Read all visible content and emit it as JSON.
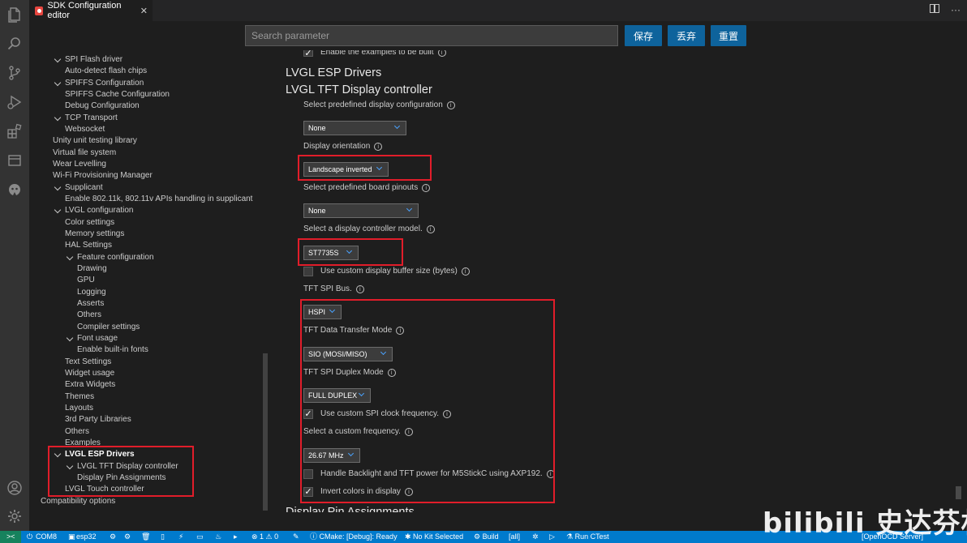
{
  "tab": {
    "title": "SDK Configuration editor",
    "close": "✕"
  },
  "search": {
    "placeholder": "Search parameter"
  },
  "buttons": {
    "save": "保存",
    "discard": "丢弃",
    "reset": "重置"
  },
  "sidebar": {
    "items": [
      {
        "label": "SPI Flash driver",
        "level": 1,
        "expanded": true
      },
      {
        "label": "Auto-detect flash chips",
        "level": 2
      },
      {
        "label": "SPIFFS Configuration",
        "level": 1,
        "expanded": true
      },
      {
        "label": "SPIFFS Cache Configuration",
        "level": 2
      },
      {
        "label": "Debug Configuration",
        "level": 2
      },
      {
        "label": "TCP Transport",
        "level": 1,
        "expanded": true
      },
      {
        "label": "Websocket",
        "level": 2
      },
      {
        "label": "Unity unit testing library",
        "level": 0
      },
      {
        "label": "Virtual file system",
        "level": 0
      },
      {
        "label": "Wear Levelling",
        "level": 0
      },
      {
        "label": "Wi-Fi Provisioning Manager",
        "level": 0
      },
      {
        "label": "Supplicant",
        "level": 1,
        "expanded": true
      },
      {
        "label": "Enable 802.11k, 802.11v APIs handling in supplicant",
        "level": 2
      },
      {
        "label": "LVGL configuration",
        "level": 1,
        "expanded": true
      },
      {
        "label": "Color settings",
        "level": 2
      },
      {
        "label": "Memory settings",
        "level": 2
      },
      {
        "label": "HAL Settings",
        "level": 2
      },
      {
        "label": "Feature configuration",
        "level": 3,
        "expanded": true
      },
      {
        "label": "Drawing",
        "level": 4
      },
      {
        "label": "GPU",
        "level": 4
      },
      {
        "label": "Logging",
        "level": 4
      },
      {
        "label": "Asserts",
        "level": 4
      },
      {
        "label": "Others",
        "level": 4
      },
      {
        "label": "Compiler settings",
        "level": 4
      },
      {
        "label": "Font usage",
        "level": 3,
        "expanded": true
      },
      {
        "label": "Enable built-in fonts",
        "level": 4
      },
      {
        "label": "Text Settings",
        "level": 2
      },
      {
        "label": "Widget usage",
        "level": 2
      },
      {
        "label": "Extra Widgets",
        "level": 2
      },
      {
        "label": "Themes",
        "level": 2
      },
      {
        "label": "Layouts",
        "level": 2
      },
      {
        "label": "3rd Party Libraries",
        "level": 2
      },
      {
        "label": "Others",
        "level": 2
      },
      {
        "label": "Examples",
        "level": 2
      },
      {
        "label": "LVGL ESP Drivers",
        "level": 1,
        "expanded": true,
        "bold": true
      },
      {
        "label": "LVGL TFT Display controller",
        "level": 3,
        "expanded": true
      },
      {
        "label": "Display Pin Assignments",
        "level": 4
      },
      {
        "label": "LVGL Touch controller",
        "level": 2
      },
      {
        "label": "Compatibility options",
        "level": -1
      }
    ]
  },
  "content": {
    "cut_top": "Enable the examples to be built",
    "section1": "LVGL ESP Drivers",
    "section2": "LVGL TFT Display controller",
    "predefined_config_label": "Select predefined display configuration",
    "predefined_config_value": "None",
    "orientation_label": "Display orientation",
    "orientation_value": "Landscape inverted",
    "board_pinouts_label": "Select predefined board pinouts",
    "board_pinouts_value": "None",
    "controller_label": "Select a display controller model.",
    "controller_value": "ST7735S",
    "custom_buffer_label": "Use custom display buffer size (bytes)",
    "spi_bus_label": "TFT SPI Bus.",
    "spi_bus_value": "HSPI",
    "transfer_mode_label": "TFT Data Transfer Mode",
    "transfer_mode_value": "SIO (MOSI/MISO)",
    "duplex_label": "TFT SPI Duplex Mode",
    "duplex_value": "FULL DUPLEX",
    "custom_clock_label": "Use custom SPI clock frequency.",
    "custom_freq_label": "Select a custom frequency.",
    "custom_freq_value": "26.67 MHz",
    "backlight_label": "Handle Backlight and TFT power for M5StickC using AXP192.",
    "invert_label": "Invert colors in display",
    "cut_bottom": "Display Pin Assignments",
    "checkmark": "✓"
  },
  "statusbar": {
    "port": "COM8",
    "target": "esp32",
    "problems": "⊗ 1 ⚠ 0",
    "cmake": "CMake: [Debug]: Ready",
    "kit": "No Kit Selected",
    "build": "Build",
    "build_target": "[all]",
    "ctest": "Run CTest",
    "openocd": "[OpenOCD Server]"
  },
  "watermark": "bilibili 史达芬林",
  "colors": {
    "accent": "#0e639c",
    "statusbar": "#007acc",
    "highlight": "#e11d2a"
  }
}
